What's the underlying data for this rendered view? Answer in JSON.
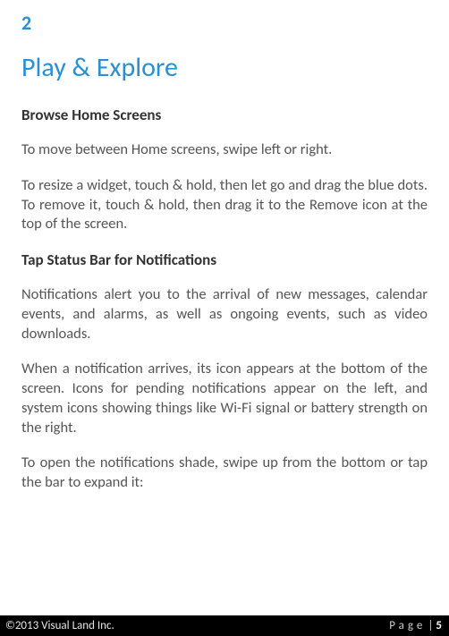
{
  "pageNumberTop": "2",
  "title": "Play & Explore",
  "sections": {
    "s1": {
      "heading": "Browse Home Screens",
      "p1": "To move between Home screens, swipe left or right.",
      "p2": "To resize a widget, touch & hold, then let go and drag the blue dots. To remove it, touch & hold, then drag it to the Remove icon at the top of the screen."
    },
    "s2": {
      "heading": "Tap Status Bar for Notifications",
      "p1": "Notifications alert you to the arrival of new messages, calendar events, and alarms, as well as ongoing events, such as video downloads.",
      "p2": "When a notification arrives, its icon appears at the bottom of the screen. Icons for pending notifications appear on the left, and system icons showing things like Wi-Fi signal or battery strength on the right.",
      "p3": "To open the notifications shade, swipe up from the bottom or tap the bar to expand it:"
    }
  },
  "footer": {
    "copyright": "©2013 Visual Land Inc.",
    "pageLabel": "Page",
    "pipe": "|",
    "pageNumber": "5"
  }
}
